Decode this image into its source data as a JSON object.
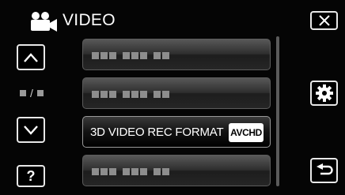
{
  "header": {
    "title": "VIDEO",
    "mode_icon": "video-camera-icon"
  },
  "controls": {
    "close_icon": "close-icon",
    "up_icon": "chevron-up-icon",
    "down_icon": "chevron-down-icon",
    "page_indicator": "/",
    "help_label": "?",
    "settings_icon": "gear-icon",
    "back_icon": "return-icon"
  },
  "menu": {
    "items": [
      {
        "label": "",
        "placeholder": true
      },
      {
        "label": "",
        "placeholder": true
      },
      {
        "label": "3D VIDEO REC FORMAT",
        "value": "AVCHD",
        "selected": true
      },
      {
        "label": "",
        "placeholder": true
      }
    ]
  },
  "colors": {
    "background": "#050505",
    "button_border": "#e8e8e8",
    "badge_bg": "#ffffff"
  }
}
